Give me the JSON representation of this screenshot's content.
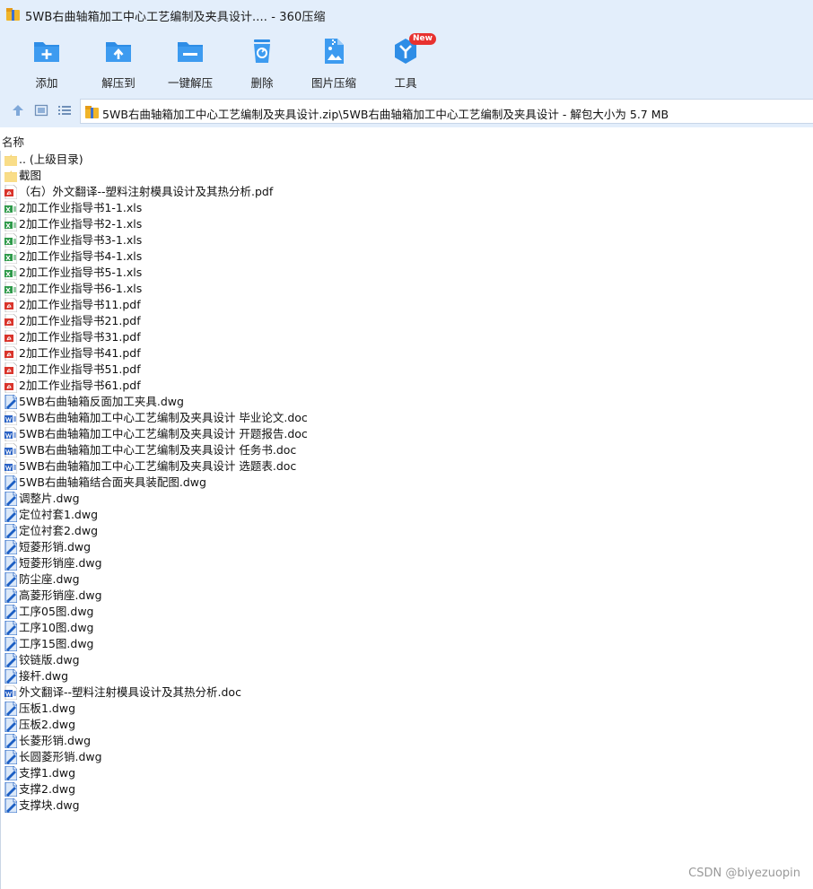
{
  "window": {
    "title": "5WB右曲轴箱加工中心工艺编制及夹具设计.... - 360压缩"
  },
  "toolbar": {
    "buttons": [
      {
        "label": "添加",
        "icon": "add-folder-icon"
      },
      {
        "label": "解压到",
        "icon": "extract-to-icon"
      },
      {
        "label": "一键解压",
        "icon": "one-click-extract-icon"
      },
      {
        "label": "删除",
        "icon": "recycle-bin-icon"
      },
      {
        "label": "图片压缩",
        "icon": "image-compress-icon"
      },
      {
        "label": "工具",
        "icon": "tools-icon",
        "badge": "New"
      }
    ]
  },
  "address": {
    "path": "5WB右曲轴箱加工中心工艺编制及夹具设计.zip\\5WB右曲轴箱加工中心工艺编制及夹具设计 - 解包大小为 5.7 MB"
  },
  "list": {
    "column_name": "名称",
    "files": [
      {
        "name": ".. (上级目录)",
        "type": "folder"
      },
      {
        "name": "截图",
        "type": "folder"
      },
      {
        "name": "（右）外文翻译--塑料注射模具设计及其热分析.pdf",
        "type": "pdf"
      },
      {
        "name": "2加工作业指导书1-1.xls",
        "type": "xls"
      },
      {
        "name": "2加工作业指导书2-1.xls",
        "type": "xls"
      },
      {
        "name": "2加工作业指导书3-1.xls",
        "type": "xls"
      },
      {
        "name": "2加工作业指导书4-1.xls",
        "type": "xls"
      },
      {
        "name": "2加工作业指导书5-1.xls",
        "type": "xls"
      },
      {
        "name": "2加工作业指导书6-1.xls",
        "type": "xls"
      },
      {
        "name": "2加工作业指导书11.pdf",
        "type": "pdf"
      },
      {
        "name": "2加工作业指导书21.pdf",
        "type": "pdf"
      },
      {
        "name": "2加工作业指导书31.pdf",
        "type": "pdf"
      },
      {
        "name": "2加工作业指导书41.pdf",
        "type": "pdf"
      },
      {
        "name": "2加工作业指导书51.pdf",
        "type": "pdf"
      },
      {
        "name": "2加工作业指导书61.pdf",
        "type": "pdf"
      },
      {
        "name": "5WB右曲轴箱反面加工夹具.dwg",
        "type": "dwg"
      },
      {
        "name": "5WB右曲轴箱加工中心工艺编制及夹具设计 毕业论文.doc",
        "type": "doc"
      },
      {
        "name": "5WB右曲轴箱加工中心工艺编制及夹具设计 开题报告.doc",
        "type": "doc"
      },
      {
        "name": "5WB右曲轴箱加工中心工艺编制及夹具设计 任务书.doc",
        "type": "doc"
      },
      {
        "name": "5WB右曲轴箱加工中心工艺编制及夹具设计 选题表.doc",
        "type": "doc"
      },
      {
        "name": "5WB右曲轴箱结合面夹具装配图.dwg",
        "type": "dwg"
      },
      {
        "name": "调整片.dwg",
        "type": "dwg"
      },
      {
        "name": "定位衬套1.dwg",
        "type": "dwg"
      },
      {
        "name": "定位衬套2.dwg",
        "type": "dwg"
      },
      {
        "name": "短菱形销.dwg",
        "type": "dwg"
      },
      {
        "name": "短菱形销座.dwg",
        "type": "dwg"
      },
      {
        "name": "防尘座.dwg",
        "type": "dwg"
      },
      {
        "name": "高菱形销座.dwg",
        "type": "dwg"
      },
      {
        "name": "工序05图.dwg",
        "type": "dwg"
      },
      {
        "name": "工序10图.dwg",
        "type": "dwg"
      },
      {
        "name": "工序15图.dwg",
        "type": "dwg"
      },
      {
        "name": "铰链版.dwg",
        "type": "dwg"
      },
      {
        "name": "接杆.dwg",
        "type": "dwg"
      },
      {
        "name": "外文翻译--塑料注射模具设计及其热分析.doc",
        "type": "doc"
      },
      {
        "name": "压板1.dwg",
        "type": "dwg"
      },
      {
        "name": "压板2.dwg",
        "type": "dwg"
      },
      {
        "name": "长菱形销.dwg",
        "type": "dwg"
      },
      {
        "name": "长圆菱形销.dwg",
        "type": "dwg"
      },
      {
        "name": "支撑1.dwg",
        "type": "dwg"
      },
      {
        "name": "支撑2.dwg",
        "type": "dwg"
      },
      {
        "name": "支撑块.dwg",
        "type": "dwg"
      }
    ]
  },
  "watermark": "CSDN @biyezuopin",
  "colors": {
    "toolbar_bg": "#e3eefb",
    "icon_blue": "#2e8de6",
    "badge_red": "#e8312f",
    "folder_yellow": "#f6d67a",
    "pdf_red": "#d9342b",
    "xls_green": "#2e9a4a",
    "doc_blue": "#2b63c5",
    "dwg_blue": "#1c5fc4"
  }
}
